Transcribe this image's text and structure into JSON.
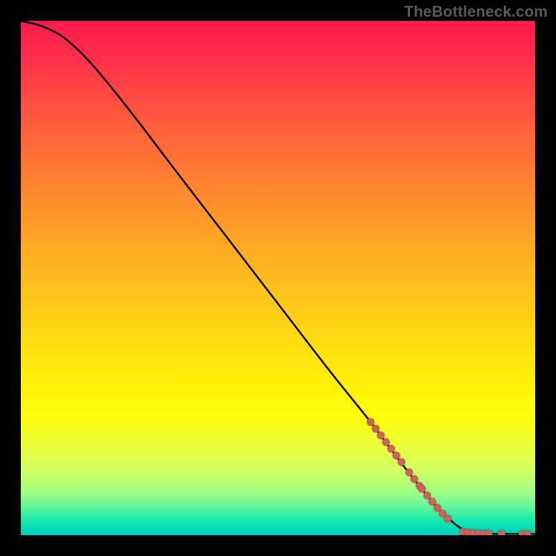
{
  "watermark": "TheBottleneck.com",
  "chart_data": {
    "type": "line",
    "title": "",
    "xlabel": "",
    "ylabel": "",
    "xlim": [
      0,
      100
    ],
    "ylim": [
      0,
      100
    ],
    "grid": false,
    "curve": [
      {
        "x": 0,
        "y": 100
      },
      {
        "x": 4,
        "y": 99
      },
      {
        "x": 8,
        "y": 97
      },
      {
        "x": 12,
        "y": 93.5
      },
      {
        "x": 16,
        "y": 89
      },
      {
        "x": 22,
        "y": 81.5
      },
      {
        "x": 30,
        "y": 71
      },
      {
        "x": 40,
        "y": 58
      },
      {
        "x": 50,
        "y": 45
      },
      {
        "x": 60,
        "y": 32
      },
      {
        "x": 68,
        "y": 22
      },
      {
        "x": 74,
        "y": 14
      },
      {
        "x": 80,
        "y": 6.5
      },
      {
        "x": 84,
        "y": 2.5
      },
      {
        "x": 86.5,
        "y": 0.8
      },
      {
        "x": 88,
        "y": 0.3
      },
      {
        "x": 100,
        "y": 0.25
      }
    ],
    "markers": [
      {
        "x": 68.0,
        "y": 22.0
      },
      {
        "x": 69.0,
        "y": 20.7
      },
      {
        "x": 70.0,
        "y": 19.4
      },
      {
        "x": 71.0,
        "y": 18.1
      },
      {
        "x": 72.0,
        "y": 16.8
      },
      {
        "x": 73.0,
        "y": 15.5
      },
      {
        "x": 74.0,
        "y": 14.2
      },
      {
        "x": 75.5,
        "y": 12.2
      },
      {
        "x": 76.5,
        "y": 10.9
      },
      {
        "x": 77.5,
        "y": 9.6
      },
      {
        "x": 78.0,
        "y": 9.0
      },
      {
        "x": 79.0,
        "y": 7.7
      },
      {
        "x": 80.0,
        "y": 6.5
      },
      {
        "x": 81.0,
        "y": 5.3
      },
      {
        "x": 82.0,
        "y": 4.2
      },
      {
        "x": 83.0,
        "y": 3.2
      },
      {
        "x": 86.0,
        "y": 0.7
      },
      {
        "x": 87.0,
        "y": 0.5
      },
      {
        "x": 88.0,
        "y": 0.4
      },
      {
        "x": 89.0,
        "y": 0.35
      },
      {
        "x": 90.0,
        "y": 0.3
      },
      {
        "x": 91.0,
        "y": 0.3
      },
      {
        "x": 93.5,
        "y": 0.28
      },
      {
        "x": 97.5,
        "y": 0.26
      },
      {
        "x": 98.5,
        "y": 0.26
      }
    ],
    "marker_radius": 5.5,
    "colors": {
      "curve": "#000000",
      "marker": "#d1635d",
      "gradient_top": "#ff1a4d",
      "gradient_mid": "#ffe010",
      "gradient_bottom": "#00d0bd"
    }
  }
}
